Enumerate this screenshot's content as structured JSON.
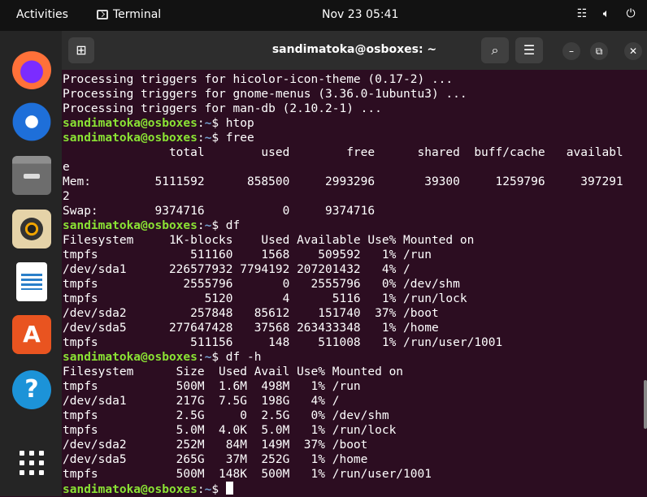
{
  "topbar": {
    "activities": "Activities",
    "app_name": "Terminal",
    "clock": "Nov 23  05:41",
    "status_icons": [
      "network-icon",
      "volume-icon",
      "power-icon"
    ]
  },
  "dock": {
    "items": [
      "firefox",
      "thunderbird",
      "files",
      "rhythmbox",
      "libreoffice-writer",
      "ubuntu-software",
      "help",
      "show-applications"
    ]
  },
  "window": {
    "title": "sandimatoka@osboxes: ~"
  },
  "prompt": {
    "user_host": "sandimatoka@osboxes",
    "path": "~"
  },
  "terminal": {
    "lines": [
      {
        "text": "Processing triggers for hicolor-icon-theme (0.17-2) ..."
      },
      {
        "text": "Processing triggers for gnome-menus (3.36.0-1ubuntu3) ..."
      },
      {
        "text": "Processing triggers for man-db (2.10.2-1) ..."
      },
      {
        "prompt": true,
        "cmd": " htop"
      },
      {
        "prompt": true,
        "cmd": " free"
      },
      {
        "text": "               total        used        free      shared  buff/cache   availabl"
      },
      {
        "text": "e"
      },
      {
        "text": "Mem:         5111592      858500     2993296       39300     1259796     397291"
      },
      {
        "text": "2"
      },
      {
        "text": "Swap:        9374716           0     9374716"
      },
      {
        "prompt": true,
        "cmd": " df"
      },
      {
        "text": "Filesystem     1K-blocks    Used Available Use% Mounted on"
      },
      {
        "text": "tmpfs             511160    1568    509592   1% /run"
      },
      {
        "text": "/dev/sda1      226577932 7794192 207201432   4% /"
      },
      {
        "text": "tmpfs            2555796       0   2555796   0% /dev/shm"
      },
      {
        "text": "tmpfs               5120       4      5116   1% /run/lock"
      },
      {
        "text": "/dev/sda2         257848   85612    151740  37% /boot"
      },
      {
        "text": "/dev/sda5      277647428   37568 263433348   1% /home"
      },
      {
        "text": "tmpfs             511156     148    511008   1% /run/user/1001"
      },
      {
        "prompt": true,
        "cmd": " df -h"
      },
      {
        "text": "Filesystem      Size  Used Avail Use% Mounted on"
      },
      {
        "text": "tmpfs           500M  1.6M  498M   1% /run"
      },
      {
        "text": "/dev/sda1       217G  7.5G  198G   4% /"
      },
      {
        "text": "tmpfs           2.5G     0  2.5G   0% /dev/shm"
      },
      {
        "text": "tmpfs           5.0M  4.0K  5.0M   1% /run/lock"
      },
      {
        "text": "/dev/sda2       252M   84M  149M  37% /boot"
      },
      {
        "text": "/dev/sda5       265G   37M  252G   1% /home"
      },
      {
        "text": "tmpfs           500M  148K  500M   1% /run/user/1001"
      },
      {
        "prompt": true,
        "cmd": " ",
        "cursor": true
      }
    ]
  },
  "colors": {
    "terminal_bg": "#2c0d21",
    "prompt_green": "#8ae234",
    "path_blue": "#729fcf",
    "header_bg": "#2d2d2d"
  }
}
